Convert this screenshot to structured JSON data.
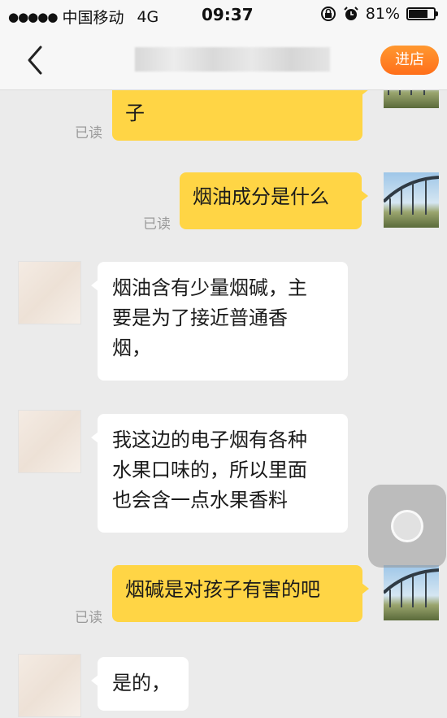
{
  "status_bar": {
    "signal_dots": "●●●●●",
    "carrier": "中国移动",
    "network": "4G",
    "time": "09:37",
    "battery_percent": "81%",
    "battery_level": 0.81
  },
  "nav": {
    "store_button": "进店"
  },
  "messages": [
    {
      "sender": "me",
      "text": "子",
      "read_label": "已读"
    },
    {
      "sender": "me",
      "text": "烟油成分是什么",
      "read_label": "已读"
    },
    {
      "sender": "them",
      "lines": [
        "烟油含有少量烟碱，主",
        "要是为了接近普通香",
        "烟，"
      ]
    },
    {
      "sender": "them",
      "lines": [
        "我这边的电子烟有各种",
        "水果口味的，所以里面",
        "也会含一点水果香料"
      ]
    },
    {
      "sender": "me",
      "text": "烟碱是对孩子有害的吧",
      "read_label": "已读"
    },
    {
      "sender": "them",
      "lines": [
        "是的，"
      ]
    }
  ],
  "colors": {
    "my_bubble": "#ffd545",
    "their_bubble": "#ffffff",
    "store_button": "#ff7a1f",
    "background": "#ebebeb"
  }
}
